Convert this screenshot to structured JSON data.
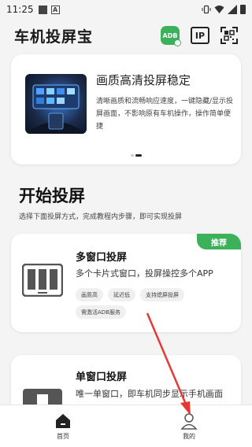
{
  "status_bar": {
    "time": "11:25",
    "notification_icons": [
      "square-icon",
      "a-icon"
    ],
    "right_icons": [
      "vibrate-icon",
      "wifi-icon",
      "signal-icon",
      "battery-icon"
    ]
  },
  "header": {
    "title": "车机投屏宝",
    "adb_label": "ADB",
    "ip_label": "IP",
    "scan_icon": "qr-scan-icon"
  },
  "banner": {
    "title": "画质高清投屏稳定",
    "description": "清晰画质和流畅响应速度，一键隐藏/显示投屏画面，不影响原有车机操作，操作简单便捷",
    "dots_count": 2,
    "active_dot": 1
  },
  "section": {
    "title": "开始投屏",
    "subtitle": "选择下面投屏方式，完成教程内步骤，即可实现投屏"
  },
  "modes": [
    {
      "title": "多窗口投屏",
      "description": "多个卡片式窗口，投屏操控多个APP",
      "badge": "推荐",
      "tags_row1": [
        "画质高",
        "延迟低",
        "支持熄屏投屏"
      ],
      "tags_row2": [
        "需激活ADB服务"
      ]
    },
    {
      "title": "单窗口投屏",
      "description": "唯一单窗口，即车机同步显示手机画面"
    }
  ],
  "bottom_nav": {
    "items": [
      {
        "label": "首页",
        "icon": "home-icon",
        "active": true
      },
      {
        "label": "我的",
        "icon": "profile-icon",
        "active": false
      }
    ]
  },
  "colors": {
    "accent_green": "#3bb15a",
    "annotation_red": "#e53935",
    "background": "#f4f4f4"
  }
}
